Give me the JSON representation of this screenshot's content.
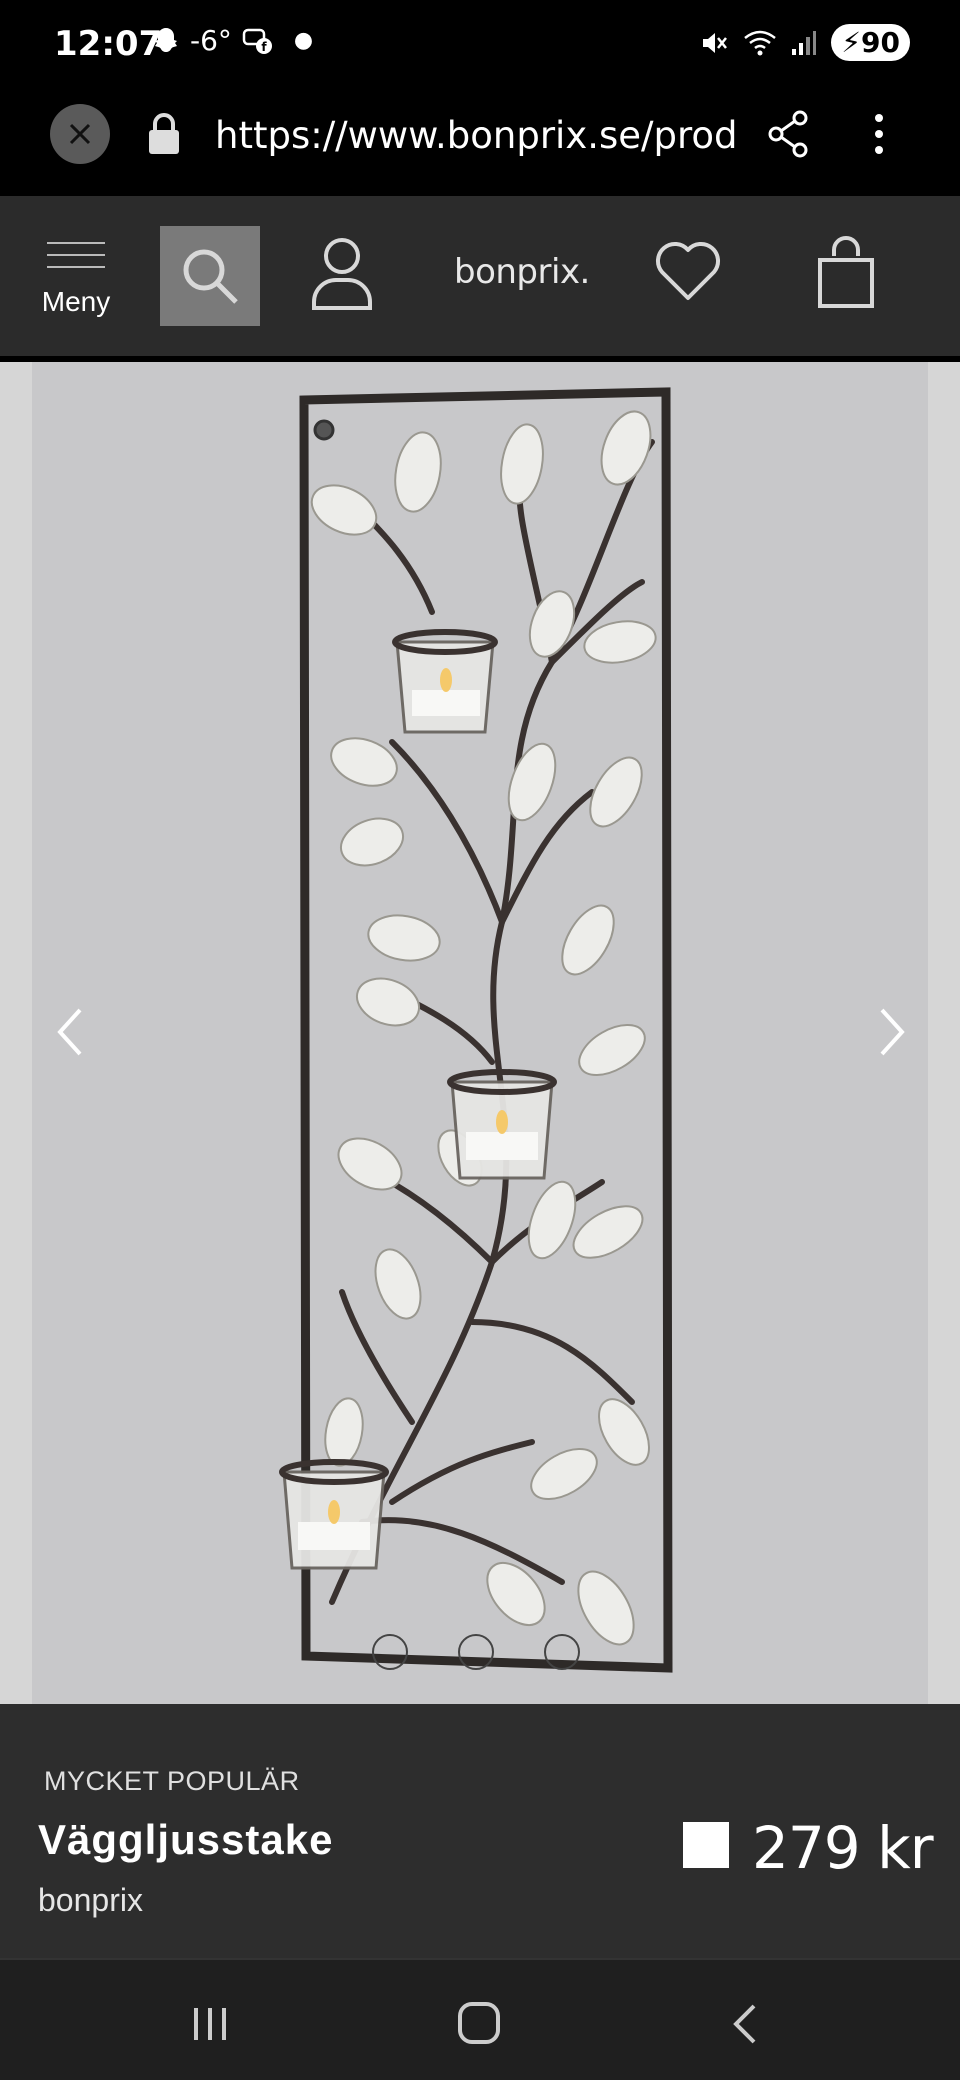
{
  "status_bar": {
    "time": "12:07",
    "temperature": "-6°",
    "battery": "90",
    "network": "5"
  },
  "browser": {
    "url": "https://www.bonprix.se/prod"
  },
  "nav": {
    "menu_label": "Meny",
    "logo_text": "bonprix."
  },
  "gallery": {
    "slide_count": 3,
    "active_slide": 1
  },
  "product": {
    "badge": "MYCKET POPULÄR",
    "title": "Väggljusstake",
    "brand": "bonprix",
    "price": "279 kr",
    "swatch_color": "#ffffff"
  }
}
